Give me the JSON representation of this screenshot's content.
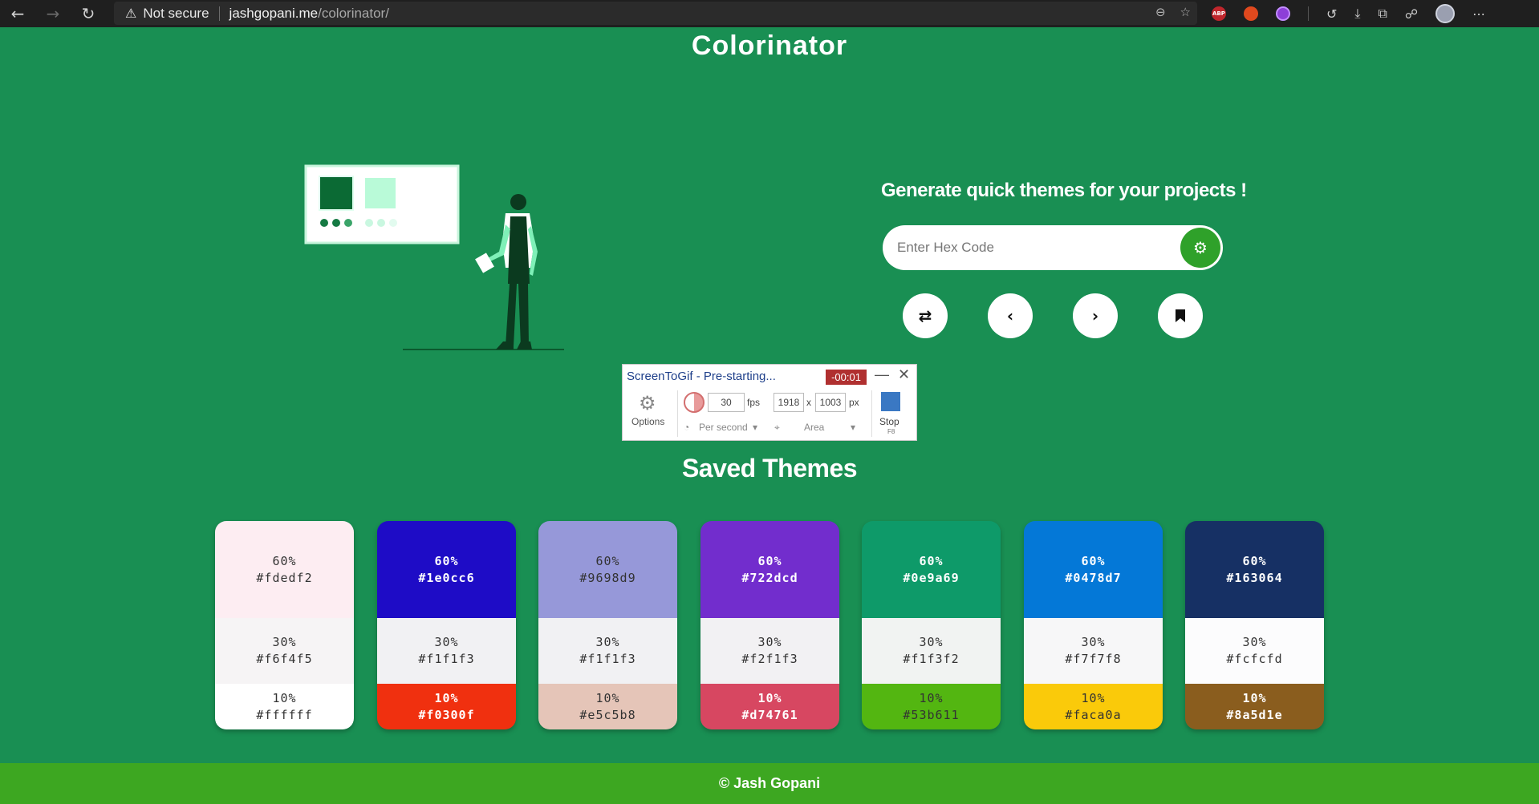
{
  "browser": {
    "security_label": "Not secure",
    "url_host": "jashgopani.me",
    "url_path": "/colorinator/"
  },
  "page": {
    "title": "Colorinator",
    "tagline": "Generate quick themes for your projects !"
  },
  "search": {
    "placeholder": "Enter Hex Code",
    "value": ""
  },
  "controls": [
    "shuffle-icon",
    "chevron-left-icon",
    "chevron-right-icon",
    "bookmark-icon"
  ],
  "overlay": {
    "title": "ScreenToGif - Pre-starting...",
    "timer": "-00:01",
    "options_label": "Options",
    "fps_value": "30",
    "fps_unit": "fps",
    "width_value": "1918",
    "height_value": "1003",
    "size_sep": "x",
    "size_unit": "px",
    "rate_label": "Per second",
    "area_label": "Area",
    "stop_label": "Stop",
    "stop_key": "F8"
  },
  "saved": {
    "title": "Saved Themes",
    "themes": [
      {
        "c60": {
          "pct": "60%",
          "hex": "#fdedf2",
          "text": "#333333"
        },
        "c30": {
          "pct": "30%",
          "hex": "#f6f4f5",
          "text": "#333333"
        },
        "c10": {
          "pct": "10%",
          "hex": "#ffffff",
          "text": "#333333"
        }
      },
      {
        "c60": {
          "pct": "60%",
          "hex": "#1e0cc6",
          "text": "#ffffff"
        },
        "c30": {
          "pct": "30%",
          "hex": "#f1f1f3",
          "text": "#333333"
        },
        "c10": {
          "pct": "10%",
          "hex": "#f0300f",
          "text": "#ffffff"
        }
      },
      {
        "c60": {
          "pct": "60%",
          "hex": "#9698d9",
          "text": "#333333"
        },
        "c30": {
          "pct": "30%",
          "hex": "#f1f1f3",
          "text": "#333333"
        },
        "c10": {
          "pct": "10%",
          "hex": "#e5c5b8",
          "text": "#333333"
        }
      },
      {
        "c60": {
          "pct": "60%",
          "hex": "#722dcd",
          "text": "#ffffff"
        },
        "c30": {
          "pct": "30%",
          "hex": "#f2f1f3",
          "text": "#333333"
        },
        "c10": {
          "pct": "10%",
          "hex": "#d74761",
          "text": "#ffffff"
        }
      },
      {
        "c60": {
          "pct": "60%",
          "hex": "#0e9a69",
          "text": "#ffffff"
        },
        "c30": {
          "pct": "30%",
          "hex": "#f1f3f2",
          "text": "#333333"
        },
        "c10": {
          "pct": "10%",
          "hex": "#53b611",
          "text": "#333333"
        }
      },
      {
        "c60": {
          "pct": "60%",
          "hex": "#0478d7",
          "text": "#ffffff"
        },
        "c30": {
          "pct": "30%",
          "hex": "#f7f7f8",
          "text": "#333333"
        },
        "c10": {
          "pct": "10%",
          "hex": "#faca0a",
          "text": "#333333"
        }
      },
      {
        "c60": {
          "pct": "60%",
          "hex": "#163064",
          "text": "#ffffff"
        },
        "c30": {
          "pct": "30%",
          "hex": "#fcfcfd",
          "text": "#333333"
        },
        "c10": {
          "pct": "10%",
          "hex": "#8a5d1e",
          "text": "#ffffff"
        }
      }
    ]
  },
  "footer": {
    "text": "© Jash Gopani"
  },
  "colors": {
    "page_bg": "#198f53",
    "footer_bg": "#3da721",
    "generate_button": "#2fa12a"
  }
}
